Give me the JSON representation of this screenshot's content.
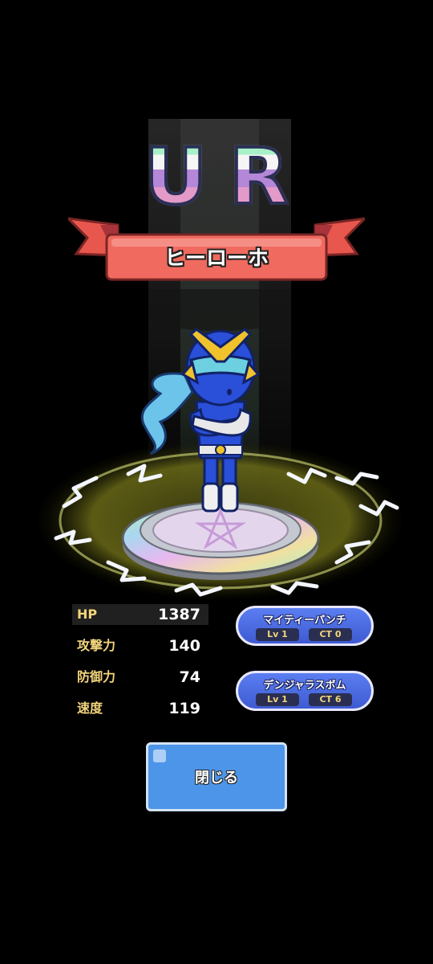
{
  "rarity": {
    "letters": [
      "U",
      "R"
    ]
  },
  "hero": {
    "name": "ヒーロー✳",
    "name_display": "ヒーローホ"
  },
  "stats": [
    {
      "label": "HP",
      "value": "1387"
    },
    {
      "label": "攻撃力",
      "value": "140"
    },
    {
      "label": "防御力",
      "value": "74"
    },
    {
      "label": "速度",
      "value": "119"
    }
  ],
  "skills": [
    {
      "name": "マイティーパンチ",
      "level": "Lv 1",
      "ct": "CT 0"
    },
    {
      "name": "デンジャラスボム",
      "level": "Lv 1",
      "ct": "CT 6"
    }
  ],
  "buttons": {
    "close": "閉じる"
  },
  "colors": {
    "background": "#000000",
    "ribbon": "#f06a5f",
    "stat_label": "#f2d57b",
    "skill_badge": "#4a68e0",
    "close_button": "#4d95e8",
    "hero_body": "#2a4fd8"
  }
}
